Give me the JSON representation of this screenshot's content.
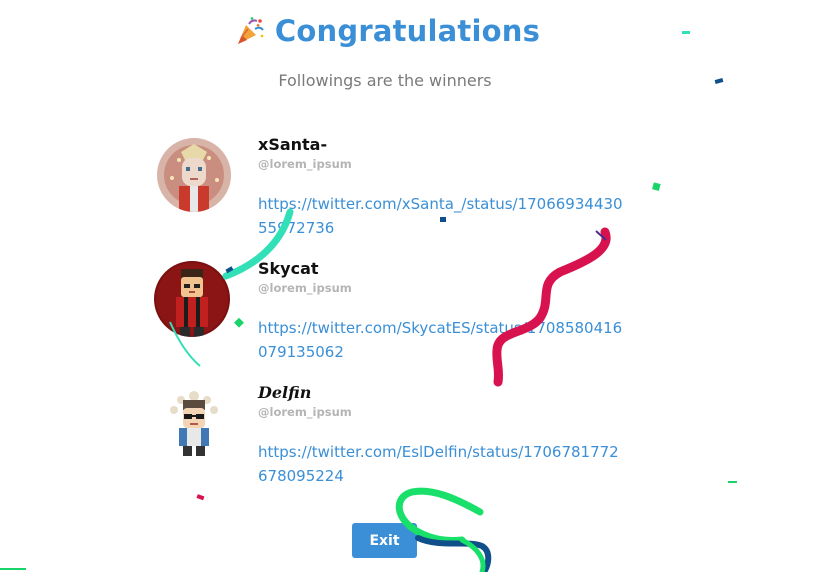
{
  "dialog": {
    "title": "Congratulations",
    "title_icon": "party-popper-icon",
    "subtitle": "Followings are the winners",
    "exit_label": "Exit",
    "accent_color": "#3a8fd6"
  },
  "winners": [
    {
      "name": "xSanta-",
      "handle": "@lorem_ipsum",
      "link": "https://twitter.com/xSanta_/status/1706693443055972736",
      "avatar": "santa-avatar"
    },
    {
      "name": "Skycat",
      "handle": "@lorem_ipsum",
      "link": "https://twitter.com/SkycatES/status/1708580416079135062",
      "avatar": "skycat-avatar"
    },
    {
      "name": "Delfin",
      "handle": "@lorem_ipsum",
      "link": "https://twitter.com/EslDelfin/status/1706781772678095224",
      "avatar": "delfin-avatar"
    }
  ]
}
